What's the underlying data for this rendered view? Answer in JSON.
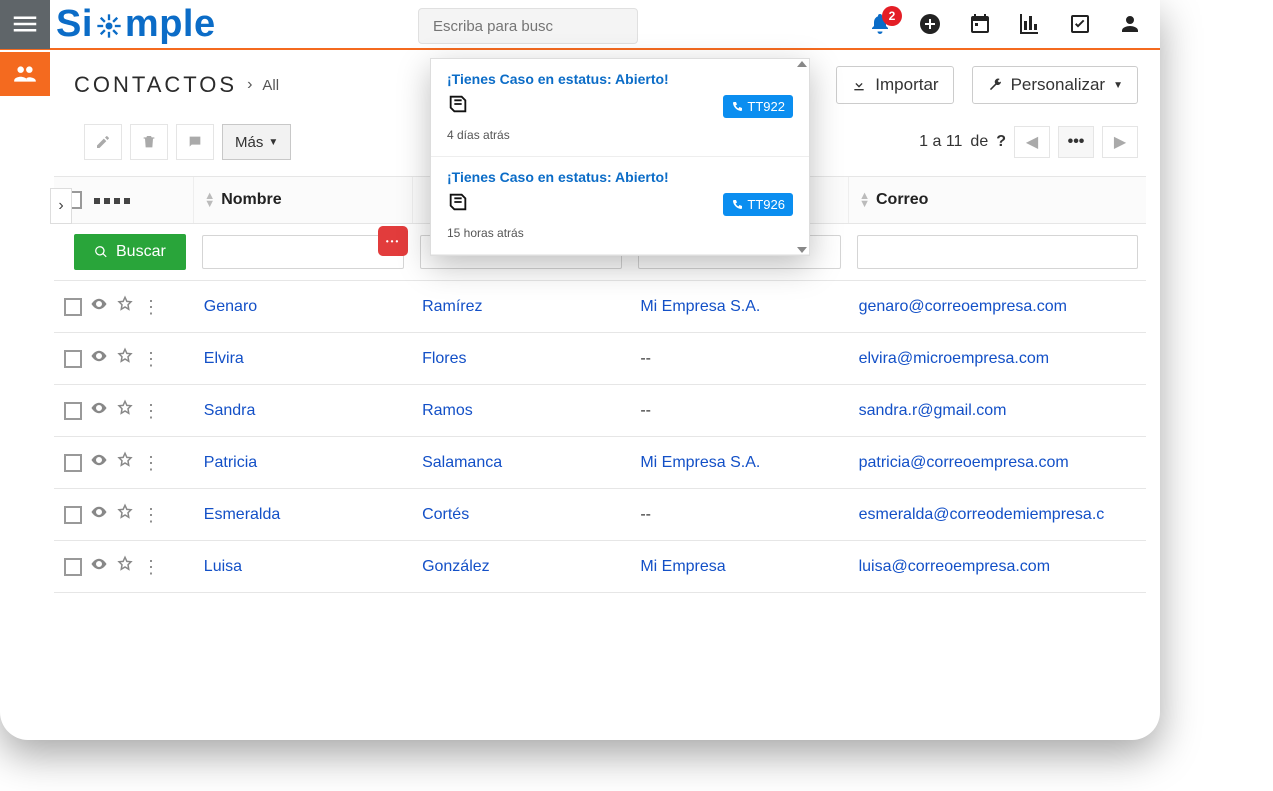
{
  "brand": {
    "part1": "S",
    "part2": "mple"
  },
  "search": {
    "placeholder": "Escriba para busc"
  },
  "notif_badge": "2",
  "breadcrumb": {
    "title": "CONTACTOS",
    "view": "All"
  },
  "head_actions": {
    "import": "Importar",
    "customize": "Personalizar"
  },
  "toolbar": {
    "more": "Más"
  },
  "pager": {
    "range": "1 a 11",
    "of": "de",
    "total": "?"
  },
  "columns": {
    "col1": "Nombre",
    "col4": "Correo"
  },
  "search_btn": "Buscar",
  "rows": [
    {
      "first": "Genaro",
      "last": "Ramírez",
      "company": "Mi Empresa S.A.",
      "email": "genaro@correoempresa.com"
    },
    {
      "first": "Elvira",
      "last": "Flores",
      "company": "--",
      "email": "elvira@microempresa.com"
    },
    {
      "first": "Sandra",
      "last": "Ramos",
      "company": "--",
      "email": "sandra.r@gmail.com"
    },
    {
      "first": "Patricia",
      "last": "Salamanca",
      "company": "Mi Empresa S.A.",
      "email": "patricia@correoempresa.com"
    },
    {
      "first": "Esmeralda",
      "last": "Cortés",
      "company": "--",
      "email": "esmeralda@correodemiempresa.c"
    },
    {
      "first": "Luisa",
      "last": "González",
      "company": "Mi Empresa",
      "email": "luisa@correoempresa.com"
    }
  ],
  "notifications": [
    {
      "title": "¡Tienes Caso en estatus: Abierto!",
      "tag": "TT922",
      "time": "4 días atrás"
    },
    {
      "title": "¡Tienes Caso en estatus: Abierto!",
      "tag": "TT926",
      "time": "15 horas atrás"
    }
  ]
}
